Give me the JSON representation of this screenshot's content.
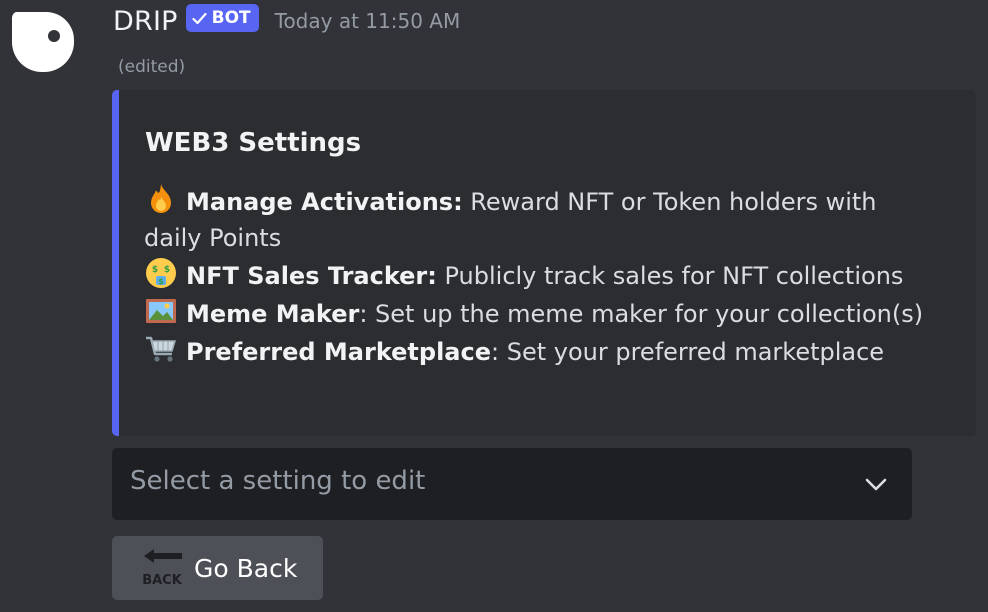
{
  "message": {
    "author": "DRIP",
    "badge": "BOT",
    "timestamp": "Today at 11:50 AM",
    "edited_label": "(edited)"
  },
  "embed": {
    "accent_color": "#5865f2",
    "title": "WEB3 Settings",
    "items": [
      {
        "icon": "fire-emoji",
        "label": "Manage Activations:",
        "text": " Reward NFT or Token holders with daily Points"
      },
      {
        "icon": "money-mouth-face-emoji",
        "label": "NFT Sales Tracker:",
        "text": " Publicly track sales for NFT collections"
      },
      {
        "icon": "framed-picture-emoji",
        "label": "Meme Maker",
        "text": ": Set up the meme maker for your collection(s)"
      },
      {
        "icon": "shopping-cart-emoji",
        "label": "Preferred Marketplace",
        "text": ": Set your preferred marketplace"
      }
    ]
  },
  "select": {
    "placeholder": "Select a setting to edit",
    "icon": "chevron-down-icon"
  },
  "button": {
    "label": "Go Back",
    "icon": "back-arrow-emoji",
    "icon_text": "BACK"
  }
}
